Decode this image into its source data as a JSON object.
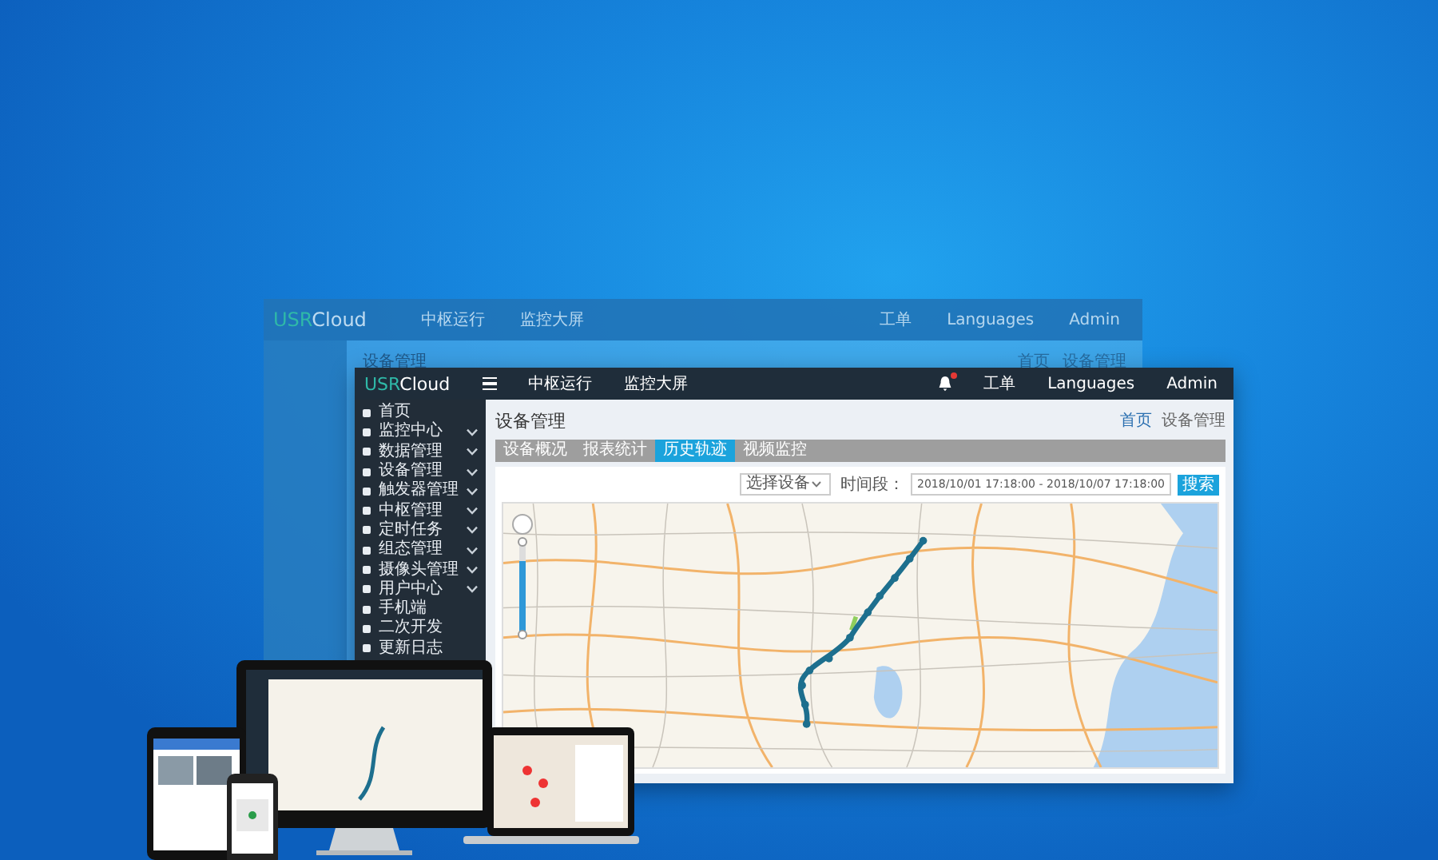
{
  "background_window": {
    "logo": {
      "prefix": "USR",
      "suffix": "Cloud"
    },
    "nav": [
      "中枢运行",
      "监控大屏"
    ],
    "header_right": [
      "工单",
      "Languages",
      "Admin"
    ],
    "page_title": "设备管理",
    "breadcrumb": [
      "首页",
      "设备管理"
    ]
  },
  "main_window": {
    "logo": {
      "prefix": "USR",
      "suffix": "Cloud"
    },
    "nav": [
      "中枢运行",
      "监控大屏"
    ],
    "notification_dot": true,
    "header_right": [
      "工单",
      "Languages",
      "Admin"
    ],
    "sidebar": [
      {
        "label": "首页",
        "expandable": false
      },
      {
        "label": "监控中心",
        "expandable": true
      },
      {
        "label": "数据管理",
        "expandable": true
      },
      {
        "label": "设备管理",
        "expandable": true
      },
      {
        "label": "触发器管理",
        "expandable": true
      },
      {
        "label": "中枢管理",
        "expandable": true
      },
      {
        "label": "定时任务",
        "expandable": true
      },
      {
        "label": "组态管理",
        "expandable": true
      },
      {
        "label": "摄像头管理",
        "expandable": true
      },
      {
        "label": "用户中心",
        "expandable": true
      },
      {
        "label": "手机端",
        "expandable": false
      },
      {
        "label": "二次开发",
        "expandable": false
      },
      {
        "label": "更新日志",
        "expandable": false
      }
    ],
    "page_title": "设备管理",
    "breadcrumb": [
      "首页",
      "设备管理"
    ],
    "tabs": [
      {
        "label": "设备概况",
        "selected": false
      },
      {
        "label": "报表统计",
        "selected": false
      },
      {
        "label": "历史轨迹",
        "selected": true
      },
      {
        "label": "视频监控",
        "selected": false
      }
    ],
    "toolbar": {
      "device_select": "选择设备",
      "time_label": "时间段：",
      "date_range": "2018/10/01 17:18:00 - 2018/10/07 17:18:00",
      "search": "搜索"
    }
  }
}
